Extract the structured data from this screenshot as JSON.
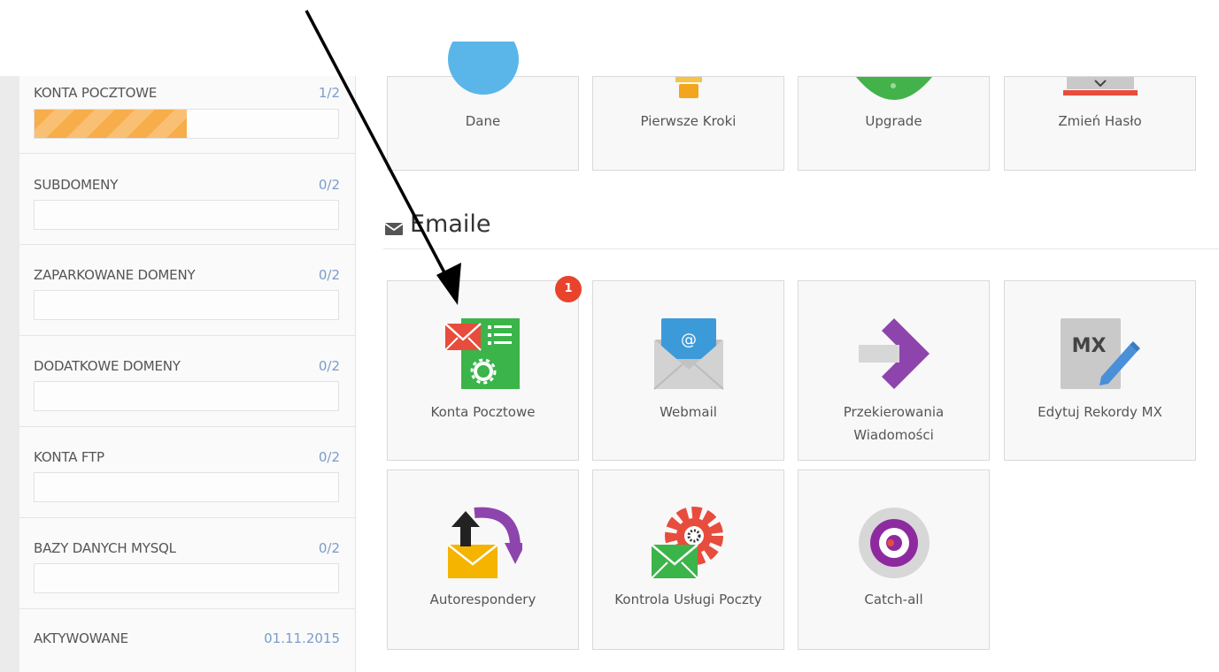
{
  "sidebar": {
    "stats": [
      {
        "label": "KONTA POCZTOWE",
        "value": "1/2",
        "fill": 0.5
      },
      {
        "label": "SUBDOMENY",
        "value": "0/2",
        "fill": 0
      },
      {
        "label": "ZAPARKOWANE DOMENY",
        "value": "0/2",
        "fill": 0
      },
      {
        "label": "DODATKOWE DOMENY",
        "value": "0/2",
        "fill": 0
      },
      {
        "label": "KONTA FTP",
        "value": "0/2",
        "fill": 0
      },
      {
        "label": "BAZY DANYCH MYSQL",
        "value": "0/2",
        "fill": 0
      }
    ],
    "activated": {
      "label": "AKTYWOWANE",
      "value": "01.11.2015"
    }
  },
  "top_tiles": [
    {
      "label": "Dane",
      "icon": "user-info-icon"
    },
    {
      "label": "Pierwsze Kroki",
      "icon": "lightbulb-icon"
    },
    {
      "label": "Upgrade",
      "icon": "upgrade-icon"
    },
    {
      "label": "Zmień Hasło",
      "icon": "password-icon"
    }
  ],
  "emails_section": {
    "title": "Emaile",
    "icon": "envelope-icon",
    "badge": "1",
    "tiles": [
      {
        "label": "Konta Pocztowe",
        "icon": "email-accounts-icon"
      },
      {
        "label": "Webmail",
        "icon": "webmail-icon"
      },
      {
        "label": "Przekierowania",
        "label2": "Wiadomości",
        "icon": "forwarders-icon"
      },
      {
        "label": "Edytuj Rekordy MX",
        "icon": "mx-records-icon",
        "icon_text": "MX"
      },
      {
        "label": "Autorespondery",
        "icon": "autoresponder-icon"
      },
      {
        "label": "Kontrola Usługi Poczty",
        "icon": "mail-service-control-icon"
      },
      {
        "label": "Catch-all",
        "icon": "catch-all-icon"
      }
    ]
  },
  "colors": {
    "progress": "#f7ad4a",
    "badge": "#e8432c",
    "link_value": "#7a9cc9",
    "arrow": "#000000"
  }
}
